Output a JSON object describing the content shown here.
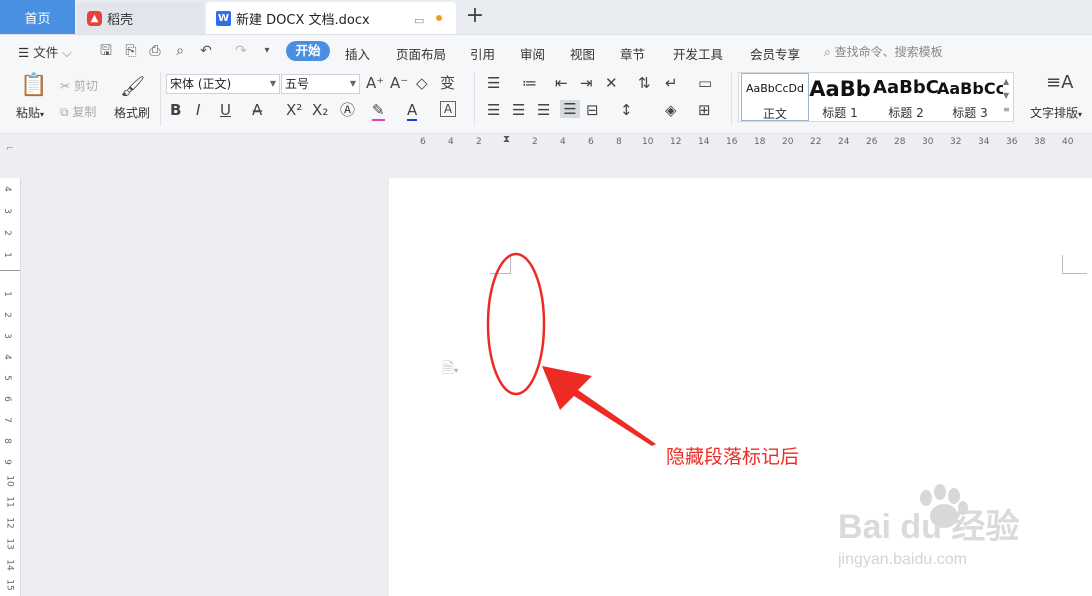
{
  "tabs": {
    "home": "首页",
    "daoke": "稻壳",
    "document": "新建 DOCX 文档.docx",
    "new_tab": "+"
  },
  "menu": {
    "file": "文件",
    "items": [
      "开始",
      "插入",
      "页面布局",
      "引用",
      "审阅",
      "视图",
      "章节",
      "开发工具",
      "会员专享"
    ],
    "search": "查找命令、搜索模板"
  },
  "ribbon": {
    "paste": "粘贴",
    "cut": "剪切",
    "copy": "复制",
    "format_painter": "格式刷",
    "font_name": "宋体 (正文)",
    "font_size": "五号",
    "bold": "B",
    "italic": "I",
    "underline": "U",
    "superscript": "X²",
    "subscript": "X₂",
    "font_color": "A",
    "char_border": "A",
    "text_layout": "文字排版",
    "styles": [
      {
        "sample": "AaBbCcDd",
        "name": "正文"
      },
      {
        "sample": "AaBb",
        "name": "标题 1"
      },
      {
        "sample": "AaBbC",
        "name": "标题 2"
      },
      {
        "sample": "AaBbCc",
        "name": "标题 3"
      }
    ]
  },
  "ruler": {
    "horizontal_ticks": [
      "6",
      "4",
      "2",
      "2",
      "4",
      "6",
      "8",
      "10",
      "12",
      "14",
      "16",
      "18",
      "20",
      "22",
      "24",
      "26",
      "28",
      "30",
      "32",
      "34",
      "36",
      "38",
      "40"
    ],
    "vertical_ticks": [
      "4",
      "3",
      "2",
      "1",
      "1",
      "2",
      "3",
      "4",
      "5",
      "6",
      "7",
      "8",
      "9",
      "10",
      "11",
      "12",
      "13",
      "14",
      "15"
    ]
  },
  "annotation": "隐藏段落标记后",
  "colors": {
    "accent": "#4a90e2",
    "annotation_red": "#ec2c24"
  },
  "watermark": {
    "brand": "Bai du 经验",
    "url": "jingyan.baidu.com"
  }
}
